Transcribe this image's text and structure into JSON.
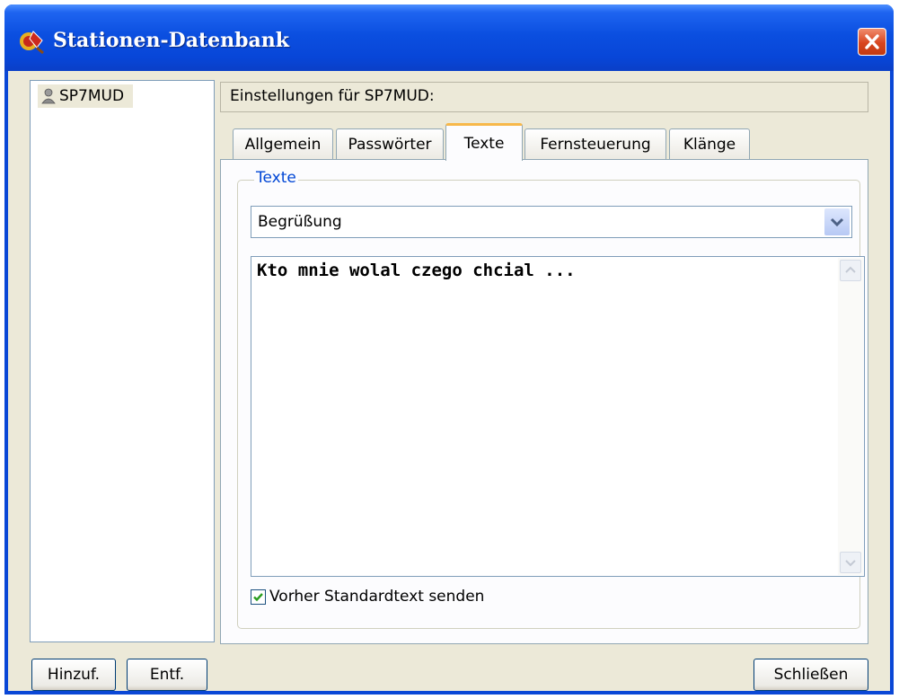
{
  "window": {
    "title": "Stationen-Datenbank"
  },
  "stations": [
    {
      "label": "SP7MUD"
    }
  ],
  "settings": {
    "header": "Einstellungen für SP7MUD:"
  },
  "tabs": [
    {
      "label": "Allgemein",
      "active": false
    },
    {
      "label": "Passwörter",
      "active": false
    },
    {
      "label": "Texte",
      "active": true
    },
    {
      "label": "Fernsteuerung",
      "active": false
    },
    {
      "label": "Klänge",
      "active": false
    }
  ],
  "texte_group": {
    "label": "Texte",
    "dropdown_value": "Begrüßung",
    "text_content": "Kto mnie wolal czego chcial ...",
    "checkbox_label": "Vorher Standardtext senden",
    "checkbox_checked": true
  },
  "buttons": {
    "add": "Hinzuf.",
    "remove": "Entf.",
    "close": "Schließen"
  },
  "icons": {
    "app": "rocket-app-icon",
    "close": "close-icon",
    "station": "person-icon",
    "dropdown": "chevron-down-icon",
    "scroll_up": "scroll-up-icon",
    "scroll_down": "scroll-down-icon",
    "check": "checkmark-icon"
  },
  "colors": {
    "titlebar": "#0846d8",
    "close": "#d8451f",
    "face": "#ece9d8",
    "group_label": "#0046d5",
    "check": "#2a9d1e"
  }
}
